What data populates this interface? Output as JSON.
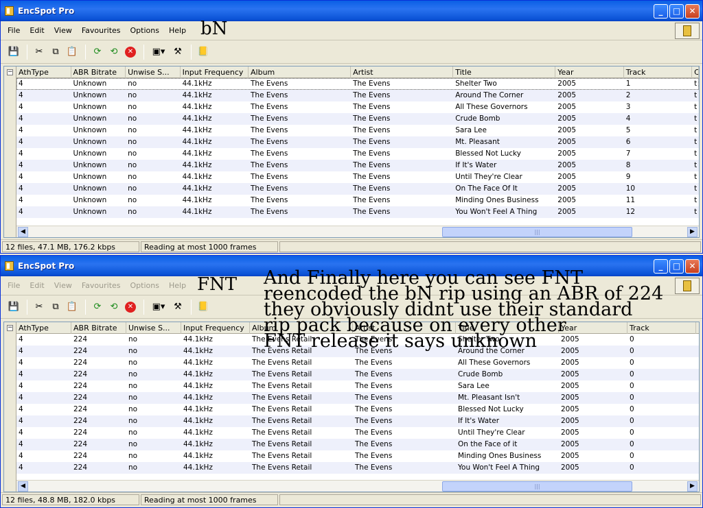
{
  "window1": {
    "title": "EncSpot Pro",
    "menu": [
      "File",
      "Edit",
      "View",
      "Favourites",
      "Options",
      "Help"
    ],
    "overlay": "bN",
    "columns": [
      "AthType",
      "ABR Bitrate",
      "Unwise S...",
      "Input Frequency",
      "Album",
      "Artist",
      "Title",
      "Year",
      "Track",
      "C"
    ],
    "rows": [
      [
        "4",
        "Unknown",
        "no",
        "44.1kHz",
        "The Evens",
        "The Evens",
        "Shelter Two",
        "2005",
        "1",
        "t"
      ],
      [
        "4",
        "Unknown",
        "no",
        "44.1kHz",
        "The Evens",
        "The Evens",
        "Around The Corner",
        "2005",
        "2",
        "t"
      ],
      [
        "4",
        "Unknown",
        "no",
        "44.1kHz",
        "The Evens",
        "The Evens",
        "All These Governors",
        "2005",
        "3",
        "t"
      ],
      [
        "4",
        "Unknown",
        "no",
        "44.1kHz",
        "The Evens",
        "The Evens",
        "Crude Bomb",
        "2005",
        "4",
        "t"
      ],
      [
        "4",
        "Unknown",
        "no",
        "44.1kHz",
        "The Evens",
        "The Evens",
        "Sara Lee",
        "2005",
        "5",
        "t"
      ],
      [
        "4",
        "Unknown",
        "no",
        "44.1kHz",
        "The Evens",
        "The Evens",
        "Mt. Pleasant",
        "2005",
        "6",
        "t"
      ],
      [
        "4",
        "Unknown",
        "no",
        "44.1kHz",
        "The Evens",
        "The Evens",
        "Blessed Not Lucky",
        "2005",
        "7",
        "t"
      ],
      [
        "4",
        "Unknown",
        "no",
        "44.1kHz",
        "The Evens",
        "The Evens",
        "If It's Water",
        "2005",
        "8",
        "t"
      ],
      [
        "4",
        "Unknown",
        "no",
        "44.1kHz",
        "The Evens",
        "The Evens",
        "Until They're Clear",
        "2005",
        "9",
        "t"
      ],
      [
        "4",
        "Unknown",
        "no",
        "44.1kHz",
        "The Evens",
        "The Evens",
        "On The Face Of It",
        "2005",
        "10",
        "t"
      ],
      [
        "4",
        "Unknown",
        "no",
        "44.1kHz",
        "The Evens",
        "The Evens",
        "Minding Ones Business",
        "2005",
        "11",
        "t"
      ],
      [
        "4",
        "Unknown",
        "no",
        "44.1kHz",
        "The Evens",
        "The Evens",
        "You Won't Feel A Thing",
        "2005",
        "12",
        "t"
      ]
    ],
    "status": [
      "12 files, 47.1 MB, 176.2 kbps",
      "Reading at most 1000 frames"
    ]
  },
  "window2": {
    "title": "EncSpot Pro",
    "menu": [
      "File",
      "Edit",
      "View",
      "Favourites",
      "Options",
      "Help"
    ],
    "overlay": "FNT",
    "columns": [
      "AthType",
      "ABR Bitrate",
      "Unwise S...",
      "Input Frequency",
      "Album",
      "Artist",
      "Title",
      "Year",
      "Track"
    ],
    "rows": [
      [
        "4",
        "224",
        "no",
        "44.1kHz",
        "The Evens Retail",
        "The Evens",
        "Shelter Two",
        "2005",
        "0"
      ],
      [
        "4",
        "224",
        "no",
        "44.1kHz",
        "The Evens Retail",
        "The Evens",
        "Around the Corner",
        "2005",
        "0"
      ],
      [
        "4",
        "224",
        "no",
        "44.1kHz",
        "The Evens Retail",
        "The Evens",
        "All These Governors",
        "2005",
        "0"
      ],
      [
        "4",
        "224",
        "no",
        "44.1kHz",
        "The Evens Retail",
        "The Evens",
        "Crude Bomb",
        "2005",
        "0"
      ],
      [
        "4",
        "224",
        "no",
        "44.1kHz",
        "The Evens Retail",
        "The Evens",
        "Sara Lee",
        "2005",
        "0"
      ],
      [
        "4",
        "224",
        "no",
        "44.1kHz",
        "The Evens Retail",
        "The Evens",
        "Mt. Pleasant Isn't",
        "2005",
        "0"
      ],
      [
        "4",
        "224",
        "no",
        "44.1kHz",
        "The Evens Retail",
        "The Evens",
        "Blessed Not Lucky",
        "2005",
        "0"
      ],
      [
        "4",
        "224",
        "no",
        "44.1kHz",
        "The Evens Retail",
        "The Evens",
        "If It's Water",
        "2005",
        "0"
      ],
      [
        "4",
        "224",
        "no",
        "44.1kHz",
        "The Evens Retail",
        "The Evens",
        "Until They're Clear",
        "2005",
        "0"
      ],
      [
        "4",
        "224",
        "no",
        "44.1kHz",
        "The Evens Retail",
        "The Evens",
        "On the Face of it",
        "2005",
        "0"
      ],
      [
        "4",
        "224",
        "no",
        "44.1kHz",
        "The Evens Retail",
        "The Evens",
        "Minding Ones Business",
        "2005",
        "0"
      ],
      [
        "4",
        "224",
        "no",
        "44.1kHz",
        "The Evens Retail",
        "The Evens",
        "You Won't Feel A Thing",
        "2005",
        "0"
      ]
    ],
    "status": [
      "12 files, 48.8 MB, 182.0 kbps",
      "Reading at most 1000 frames"
    ]
  },
  "annotation": [
    "And Finally here you can see FNT",
    "reencoded the bN rip using an ABR of 224",
    "they obviously didnt use their standard",
    "rip pack because  on every other",
    "FNT release it says unknown"
  ],
  "icons": [
    "save-icon",
    "cut-icon",
    "copy-icon",
    "paste-icon",
    "refresh-icon",
    "refresh-all-icon",
    "stop-icon",
    "options-icon",
    "tools-icon",
    "book-icon"
  ]
}
